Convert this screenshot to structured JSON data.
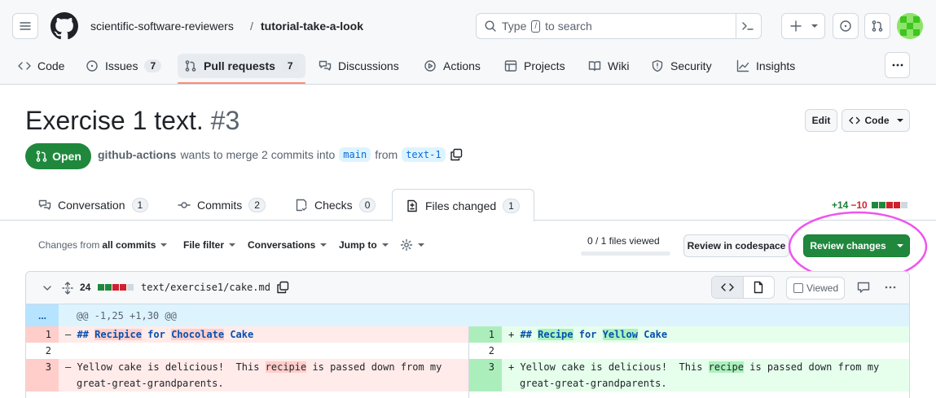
{
  "header": {
    "owner": "scientific-software-reviewers",
    "separator": "/",
    "repo": "tutorial-take-a-look",
    "search_prefix": "Type",
    "search_key": "/",
    "search_suffix": "to search"
  },
  "nav": [
    {
      "label": "Code",
      "count": null
    },
    {
      "label": "Issues",
      "count": "7"
    },
    {
      "label": "Pull requests",
      "count": "7"
    },
    {
      "label": "Discussions",
      "count": null
    },
    {
      "label": "Actions",
      "count": null
    },
    {
      "label": "Projects",
      "count": null
    },
    {
      "label": "Wiki",
      "count": null
    },
    {
      "label": "Security",
      "count": null
    },
    {
      "label": "Insights",
      "count": null
    }
  ],
  "pr": {
    "title": "Exercise 1 text.",
    "number": "#3",
    "edit_label": "Edit",
    "code_label": "Code",
    "state": "Open",
    "author": "github-actions",
    "merge_text": "wants to merge 2 commits into",
    "base_branch": "main",
    "from_text": "from",
    "head_branch": "text-1"
  },
  "tabs": [
    {
      "label": "Conversation",
      "count": "1"
    },
    {
      "label": "Commits",
      "count": "2"
    },
    {
      "label": "Checks",
      "count": "0"
    },
    {
      "label": "Files changed",
      "count": "1"
    }
  ],
  "diffstat": {
    "additions": "+14",
    "deletions": "−10"
  },
  "toolbar": {
    "changes_from_prefix": "Changes from",
    "changes_from_value": "all commits",
    "file_filter": "File filter",
    "conversations": "Conversations",
    "jump_to": "Jump to",
    "files_viewed": "0 / 1 files viewed",
    "review_codespace": "Review in codespace",
    "review_changes": "Review changes"
  },
  "file": {
    "changes": "24",
    "path": "text/exercise1/cake.md",
    "viewed_label": "Viewed",
    "expand_label": "...",
    "hunk": "@@ -1,25 +1,30 @@"
  },
  "diff": {
    "left": [
      {
        "num": "1",
        "marker": "–",
        "parts": [
          [
            "kw",
            "## "
          ],
          [
            "kw-hl",
            "Recipice"
          ],
          [
            "kw",
            " for "
          ],
          [
            "kw-hl",
            "Chocolate"
          ],
          [
            "kw",
            " Cake"
          ]
        ]
      },
      {
        "num": "2",
        "marker": "",
        "parts": []
      },
      {
        "num": "3",
        "marker": "–",
        "parts": [
          [
            "t",
            "Yellow cake is delicious!  This "
          ],
          [
            "hl",
            "recipie"
          ],
          [
            "t",
            " is passed down from my"
          ]
        ],
        "cont": "great-great-grandparents."
      }
    ],
    "right": [
      {
        "num": "1",
        "marker": "+",
        "parts": [
          [
            "kw",
            "## "
          ],
          [
            "kw-hl",
            "Recipe"
          ],
          [
            "kw",
            " for "
          ],
          [
            "kw-hl",
            "Yellow"
          ],
          [
            "kw",
            " Cake"
          ]
        ]
      },
      {
        "num": "2",
        "marker": "",
        "parts": []
      },
      {
        "num": "3",
        "marker": "+",
        "parts": [
          [
            "t",
            "Yellow cake is delicious!  This "
          ],
          [
            "hl",
            "recipe"
          ],
          [
            "t",
            " is passed down from my"
          ]
        ],
        "cont": "great-great-grandparents."
      }
    ]
  },
  "colors": {
    "open_green": "#1f883d",
    "annotation_circle": "#ee55ee",
    "link_blue": "#0969da",
    "tab_underline": "#fd8c73"
  }
}
